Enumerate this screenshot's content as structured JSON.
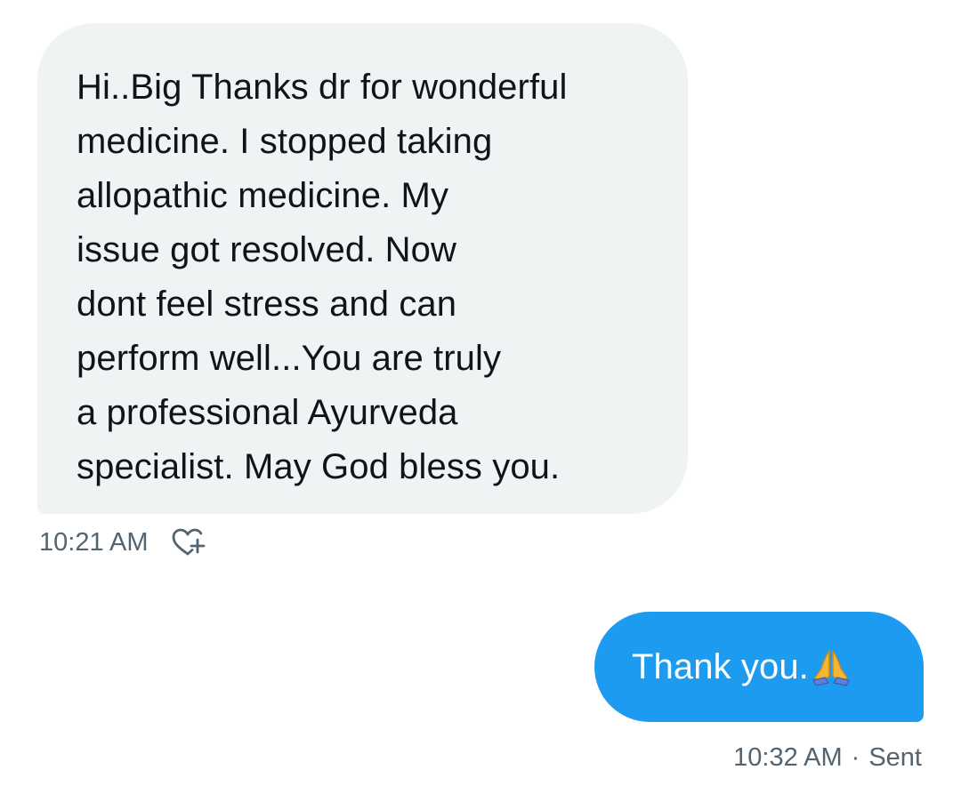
{
  "conversation": {
    "received_message": {
      "text": "Hi..Big Thanks dr for wonderful\nmedicine. I stopped taking\nallopathic medicine. My\nissue got resolved. Now\ndont feel stress and can\nperform well...You are truly\na professional Ayurveda\nspecialist. May God bless you.",
      "time": "10:21 AM",
      "react_icon": "heart-plus-icon"
    },
    "sent_message": {
      "text": "Thank you.",
      "emoji": "folded-hands-icon",
      "time": "10:32 AM",
      "separator": "·",
      "status": "Sent"
    }
  },
  "colors": {
    "received_bubble": "#eff3f4",
    "sent_bubble": "#1d9bf0",
    "meta_text": "#536471",
    "body_text": "#0f1419"
  }
}
